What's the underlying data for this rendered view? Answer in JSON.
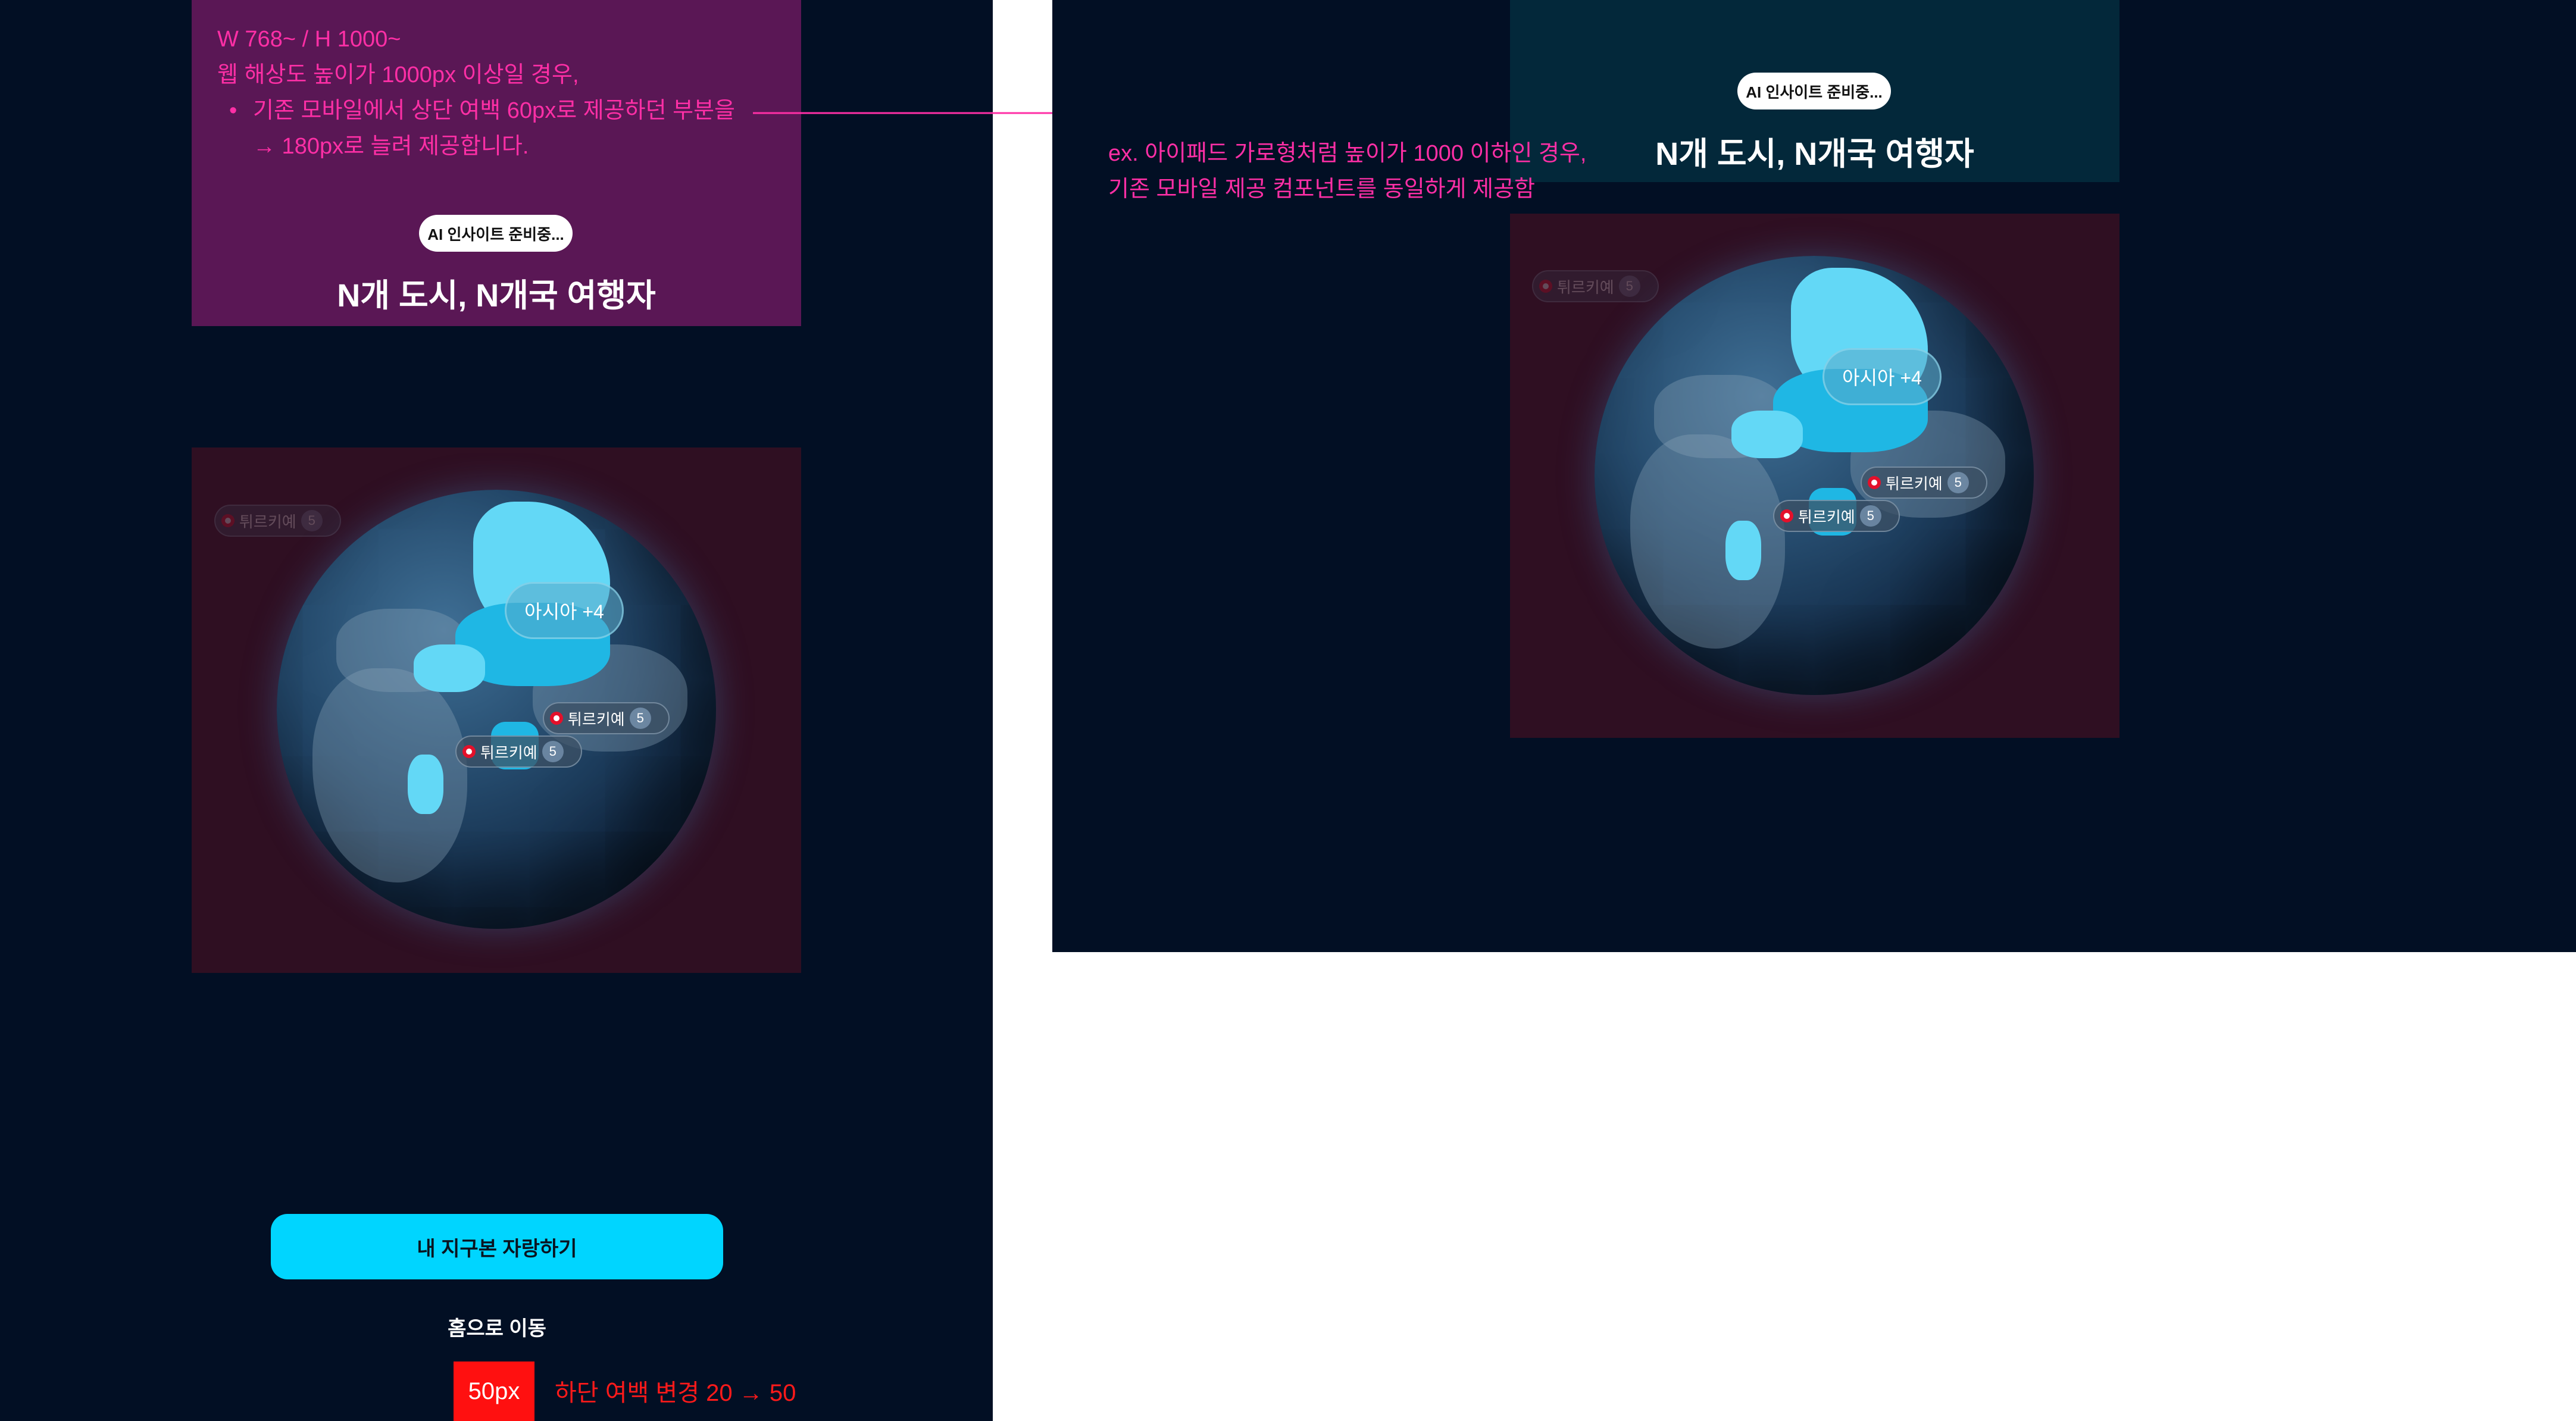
{
  "left_note": {
    "line1": "W 768~ / H 1000~",
    "line2": "웹 해상도 높이가 1000px 이상일 경우,",
    "bullet": "•",
    "line3": "기존 모바일에서 상단 여백 60px로 제공하던 부분을",
    "line4": "→ 180px로 늘려 제공합니다."
  },
  "right_note": {
    "line1": "ex. 아이패드 가로형처럼 높이가 1000 이하인 경우,",
    "line2": "기존 모바일 제공 컴포넌트를 동일하게 제공함"
  },
  "badge": {
    "label": "AI 인사이트 준비중..."
  },
  "headline": {
    "text": "N개 도시, N개국 여행자"
  },
  "globe": {
    "asia_label": "아시아 +4",
    "chips": [
      {
        "country": "튀르키예",
        "count": "5"
      },
      {
        "country": "튀르키예",
        "count": "5"
      },
      {
        "country": "튀르키예",
        "count": "5"
      }
    ]
  },
  "actions": {
    "primary_button": "내 지구본 자랑하기",
    "home_link": "홈으로 이동"
  },
  "spacing_annotation": {
    "badge": "50px",
    "note": "하단 여백 변경 20 → 50"
  },
  "colors": {
    "background": "#020f24",
    "annotation_pink": "#ff2fa6",
    "annotation_red": "#ff1a1a",
    "cta": "#00d5ff",
    "highlight_land": "#63d8f6"
  }
}
